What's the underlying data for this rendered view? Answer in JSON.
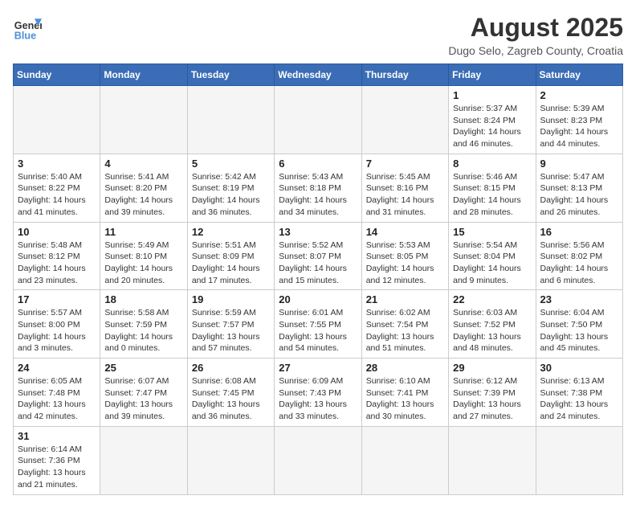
{
  "header": {
    "logo_general": "General",
    "logo_blue": "Blue",
    "title": "August 2025",
    "subtitle": "Dugo Selo, Zagreb County, Croatia"
  },
  "days_of_week": [
    "Sunday",
    "Monday",
    "Tuesday",
    "Wednesday",
    "Thursday",
    "Friday",
    "Saturday"
  ],
  "weeks": [
    [
      {
        "day": "",
        "info": ""
      },
      {
        "day": "",
        "info": ""
      },
      {
        "day": "",
        "info": ""
      },
      {
        "day": "",
        "info": ""
      },
      {
        "day": "",
        "info": ""
      },
      {
        "day": "1",
        "info": "Sunrise: 5:37 AM\nSunset: 8:24 PM\nDaylight: 14 hours and 46 minutes."
      },
      {
        "day": "2",
        "info": "Sunrise: 5:39 AM\nSunset: 8:23 PM\nDaylight: 14 hours and 44 minutes."
      }
    ],
    [
      {
        "day": "3",
        "info": "Sunrise: 5:40 AM\nSunset: 8:22 PM\nDaylight: 14 hours and 41 minutes."
      },
      {
        "day": "4",
        "info": "Sunrise: 5:41 AM\nSunset: 8:20 PM\nDaylight: 14 hours and 39 minutes."
      },
      {
        "day": "5",
        "info": "Sunrise: 5:42 AM\nSunset: 8:19 PM\nDaylight: 14 hours and 36 minutes."
      },
      {
        "day": "6",
        "info": "Sunrise: 5:43 AM\nSunset: 8:18 PM\nDaylight: 14 hours and 34 minutes."
      },
      {
        "day": "7",
        "info": "Sunrise: 5:45 AM\nSunset: 8:16 PM\nDaylight: 14 hours and 31 minutes."
      },
      {
        "day": "8",
        "info": "Sunrise: 5:46 AM\nSunset: 8:15 PM\nDaylight: 14 hours and 28 minutes."
      },
      {
        "day": "9",
        "info": "Sunrise: 5:47 AM\nSunset: 8:13 PM\nDaylight: 14 hours and 26 minutes."
      }
    ],
    [
      {
        "day": "10",
        "info": "Sunrise: 5:48 AM\nSunset: 8:12 PM\nDaylight: 14 hours and 23 minutes."
      },
      {
        "day": "11",
        "info": "Sunrise: 5:49 AM\nSunset: 8:10 PM\nDaylight: 14 hours and 20 minutes."
      },
      {
        "day": "12",
        "info": "Sunrise: 5:51 AM\nSunset: 8:09 PM\nDaylight: 14 hours and 17 minutes."
      },
      {
        "day": "13",
        "info": "Sunrise: 5:52 AM\nSunset: 8:07 PM\nDaylight: 14 hours and 15 minutes."
      },
      {
        "day": "14",
        "info": "Sunrise: 5:53 AM\nSunset: 8:05 PM\nDaylight: 14 hours and 12 minutes."
      },
      {
        "day": "15",
        "info": "Sunrise: 5:54 AM\nSunset: 8:04 PM\nDaylight: 14 hours and 9 minutes."
      },
      {
        "day": "16",
        "info": "Sunrise: 5:56 AM\nSunset: 8:02 PM\nDaylight: 14 hours and 6 minutes."
      }
    ],
    [
      {
        "day": "17",
        "info": "Sunrise: 5:57 AM\nSunset: 8:00 PM\nDaylight: 14 hours and 3 minutes."
      },
      {
        "day": "18",
        "info": "Sunrise: 5:58 AM\nSunset: 7:59 PM\nDaylight: 14 hours and 0 minutes."
      },
      {
        "day": "19",
        "info": "Sunrise: 5:59 AM\nSunset: 7:57 PM\nDaylight: 13 hours and 57 minutes."
      },
      {
        "day": "20",
        "info": "Sunrise: 6:01 AM\nSunset: 7:55 PM\nDaylight: 13 hours and 54 minutes."
      },
      {
        "day": "21",
        "info": "Sunrise: 6:02 AM\nSunset: 7:54 PM\nDaylight: 13 hours and 51 minutes."
      },
      {
        "day": "22",
        "info": "Sunrise: 6:03 AM\nSunset: 7:52 PM\nDaylight: 13 hours and 48 minutes."
      },
      {
        "day": "23",
        "info": "Sunrise: 6:04 AM\nSunset: 7:50 PM\nDaylight: 13 hours and 45 minutes."
      }
    ],
    [
      {
        "day": "24",
        "info": "Sunrise: 6:05 AM\nSunset: 7:48 PM\nDaylight: 13 hours and 42 minutes."
      },
      {
        "day": "25",
        "info": "Sunrise: 6:07 AM\nSunset: 7:47 PM\nDaylight: 13 hours and 39 minutes."
      },
      {
        "day": "26",
        "info": "Sunrise: 6:08 AM\nSunset: 7:45 PM\nDaylight: 13 hours and 36 minutes."
      },
      {
        "day": "27",
        "info": "Sunrise: 6:09 AM\nSunset: 7:43 PM\nDaylight: 13 hours and 33 minutes."
      },
      {
        "day": "28",
        "info": "Sunrise: 6:10 AM\nSunset: 7:41 PM\nDaylight: 13 hours and 30 minutes."
      },
      {
        "day": "29",
        "info": "Sunrise: 6:12 AM\nSunset: 7:39 PM\nDaylight: 13 hours and 27 minutes."
      },
      {
        "day": "30",
        "info": "Sunrise: 6:13 AM\nSunset: 7:38 PM\nDaylight: 13 hours and 24 minutes."
      }
    ],
    [
      {
        "day": "31",
        "info": "Sunrise: 6:14 AM\nSunset: 7:36 PM\nDaylight: 13 hours and 21 minutes."
      },
      {
        "day": "",
        "info": ""
      },
      {
        "day": "",
        "info": ""
      },
      {
        "day": "",
        "info": ""
      },
      {
        "day": "",
        "info": ""
      },
      {
        "day": "",
        "info": ""
      },
      {
        "day": "",
        "info": ""
      }
    ]
  ]
}
